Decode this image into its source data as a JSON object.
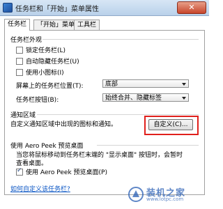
{
  "window": {
    "title": "任务栏和「开始」菜单属性",
    "close_glyph": "✕"
  },
  "tabs": [
    {
      "label": "任务栏",
      "active": true
    },
    {
      "label": "「开始」菜单",
      "active": false
    },
    {
      "label": "工具栏",
      "active": false
    }
  ],
  "taskbar_appearance": {
    "title": "任务栏外观",
    "lock": {
      "label": "锁定任务栏(L)",
      "checked": false
    },
    "autohide": {
      "label": "自动隐藏任务栏(U)",
      "checked": false
    },
    "small_icons": {
      "label": "使用小图标(I)",
      "checked": false
    },
    "position": {
      "label": "屏幕上的任务栏位置(T):",
      "value": "底部"
    },
    "buttons": {
      "label": "任务栏按钮(B):",
      "value": "始终合并、隐藏标签"
    }
  },
  "notification_area": {
    "title": "通知区域",
    "description": "自定义通知区域中出现的图标和通知。",
    "customize_label": "自定义(C)...",
    "highlight_color": "#e0201c"
  },
  "aero_peek": {
    "title": "使用 Aero Peek 预览桌面",
    "description_line1": "当您将鼠标移动到任务栏末端的 \"显示桌面\" 按钮时，会暂时",
    "description_line2": "查看桌面。",
    "checkbox": {
      "label": "使用 Aero Peek 预览桌面(P)",
      "checked": true
    }
  },
  "help_link": "如何自定义该任务栏?",
  "watermark": {
    "text": "装机之家",
    "url": "www.lotpc.com"
  },
  "colors": {
    "link": "#0b56c4",
    "accent": "#2a5fb5"
  }
}
